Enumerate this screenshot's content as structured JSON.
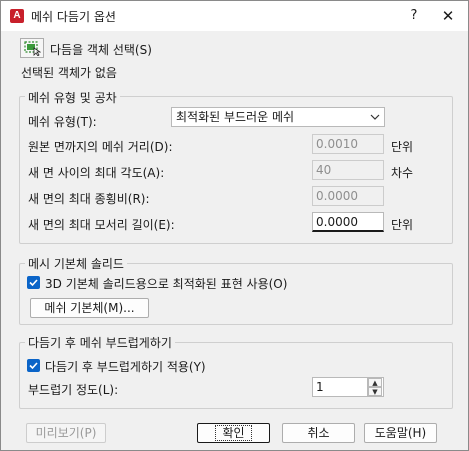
{
  "window": {
    "title": "메쉬 다듬기 옵션",
    "app_icon_letter": "A",
    "help_glyph": "?",
    "close_glyph": "✕"
  },
  "selection": {
    "pick_label": "다듬을 객체 선택(S)",
    "status": "선택된 객체가 없음"
  },
  "mesh_type": {
    "group_title": "메쉬 유형 및 공차",
    "type_label": "메쉬 유형(T):",
    "type_value": "최적화된 부드러운 메쉬",
    "distance_label": "원본 면까지의 메쉬 거리(D):",
    "distance_value": "0.0010",
    "distance_unit": "단위",
    "angle_label": "새 면 사이의 최대 각도(A):",
    "angle_value": "40",
    "angle_unit": "차수",
    "aspect_label": "새 면의 최대 종횡비(R):",
    "aspect_value": "0.0000",
    "edge_label": "새 면의 최대 모서리 길이(E):",
    "edge_value": "0.0000",
    "edge_unit": "단위"
  },
  "primitive": {
    "group_title": "메시 기본체 솔리드",
    "checkbox_label": "3D 기본체 솔리드용으로 최적화된 표현 사용(O)",
    "button_label": "메쉬 기본체(M)..."
  },
  "smoothing": {
    "group_title": "다듬기 후 메쉬 부드럽게하기",
    "checkbox_label": "다듬기 후 부드럽게하기 적용(Y)",
    "level_label": "부드럽기 정도(L):",
    "level_value": "1"
  },
  "footer": {
    "preview_label": "미리보기(P)",
    "ok_label": "확인",
    "cancel_label": "취소",
    "help_label": "도움말(H)"
  }
}
